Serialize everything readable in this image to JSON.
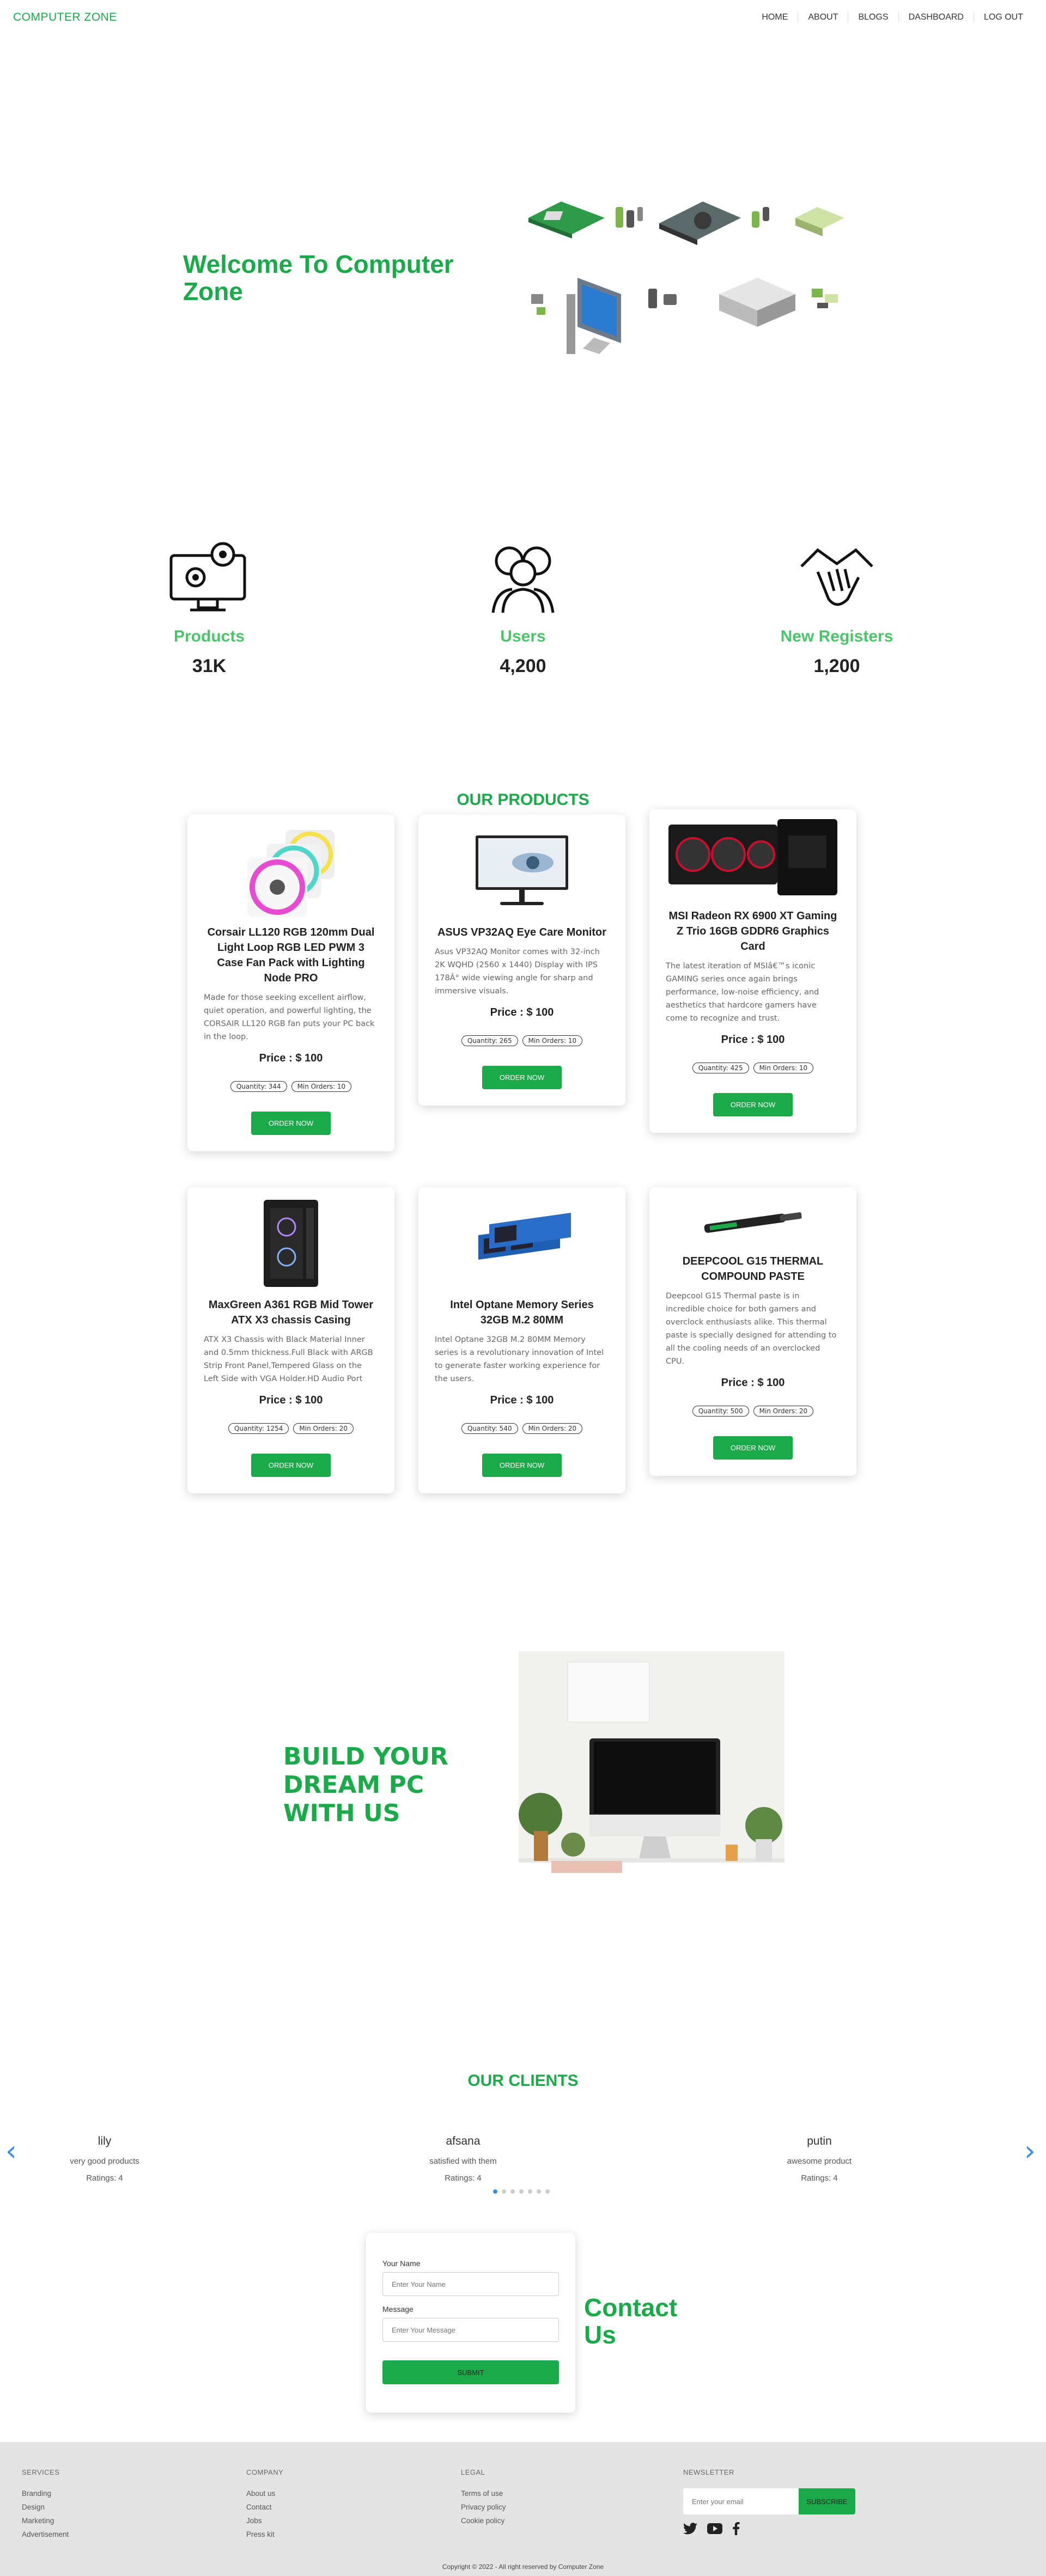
{
  "nav": {
    "brand": "COMPUTER ZONE",
    "links": [
      "HOME",
      "ABOUT",
      "BLOGS",
      "DASHBOARD",
      "LOG OUT"
    ]
  },
  "hero": {
    "title": "Welcome To Computer Zone"
  },
  "stats": [
    {
      "label": "Products",
      "value": "31K",
      "icon": "computer-settings-icon"
    },
    {
      "label": "Users",
      "value": "4,200",
      "icon": "users-icon"
    },
    {
      "label": "New Registers",
      "value": "1,200",
      "icon": "handshake-icon"
    }
  ],
  "products": {
    "title": "OUR PRODUCTS",
    "items": [
      {
        "name": "Corsair LL120 RGB 120mm Dual Light Loop RGB LED PWM 3 Case Fan Pack with Lighting Node PRO",
        "desc": "Made for those seeking excellent airflow, quiet operation, and powerful lighting, the CORSAIR LL120 RGB fan puts your PC back in the loop.",
        "price": "Price : $ 100",
        "quantity": "Quantity: 344",
        "min_orders": "Min Orders: 10",
        "button": "ORDER NOW"
      },
      {
        "name": "ASUS VP32AQ Eye Care Monitor",
        "desc": "Asus VP32AQ Monitor comes with 32-inch 2K WQHD (2560 x 1440) Display with IPS 178Â° wide viewing angle for sharp and immersive visuals.",
        "price": "Price : $ 100",
        "quantity": "Quantity: 265",
        "min_orders": "Min Orders: 10",
        "button": "ORDER NOW"
      },
      {
        "name": "MSI Radeon RX 6900 XT Gaming Z Trio 16GB GDDR6 Graphics Card",
        "desc": "The latest iteration of MSIâ€™s iconic GAMING series once again brings performance, low-noise efficiency, and aesthetics that hardcore gamers have come to recognize and trust.",
        "price": "Price : $ 100",
        "quantity": "Quantity: 425",
        "min_orders": "Min Orders: 10",
        "button": "ORDER NOW"
      },
      {
        "name": "MaxGreen A361 RGB Mid Tower ATX X3 chassis Casing",
        "desc": "ATX X3 Chassis with Black Material Inner and 0.5mm thickness.Full Black with ARGB Strip Front Panel,Tempered Glass on the Left Side with VGA Holder.HD Audio Port",
        "price": "Price : $ 100",
        "quantity": "Quantity: 1254",
        "min_orders": "Min Orders: 20",
        "button": "ORDER NOW"
      },
      {
        "name": "Intel Optane Memory Series 32GB M.2 80MM",
        "desc": "Intel Optane 32GB M.2 80MM Memory series is a revolutionary innovation of Intel to generate faster working experience for the users.",
        "price": "Price : $ 100",
        "quantity": "Quantity: 540",
        "min_orders": "Min Orders: 20",
        "button": "ORDER NOW"
      },
      {
        "name": "DEEPCOOL G15 THERMAL COMPOUND PASTE",
        "desc": "Deepcool G15 Thermal paste is in incredible choice for both gamers and overclock enthusiasts alike. This thermal paste is specially designed for attending to all the cooling needs of an overclocked CPU.",
        "price": "Price : $ 100",
        "quantity": "Quantity: 500",
        "min_orders": "Min Orders: 20",
        "button": "ORDER NOW"
      }
    ]
  },
  "dream": {
    "line1": "BUILD YOUR DREAM PC",
    "line2": "WITH US"
  },
  "clients": {
    "title": "OUR CLIENTS",
    "items": [
      {
        "name": "lily",
        "desc": "very good products",
        "rating": "Ratings: 4"
      },
      {
        "name": "afsana",
        "desc": "satisfied with them",
        "rating": "Ratings: 4"
      },
      {
        "name": "putin",
        "desc": "awesome product",
        "rating": "Ratings: 4"
      }
    ],
    "prev": "‹",
    "next": "›"
  },
  "contact": {
    "title_line1": "Contact",
    "title_line2": "Us",
    "name_label": "Your Name",
    "name_placeholder": "Enter Your Name",
    "message_label": "Message",
    "message_placeholder": "Enter Your Message",
    "submit": "SUBMIT"
  },
  "footer": {
    "services": {
      "title": "SERVICES",
      "links": [
        "Branding",
        "Design",
        "Marketing",
        "Advertisement"
      ]
    },
    "company": {
      "title": "COMPANY",
      "links": [
        "About us",
        "Contact",
        "Jobs",
        "Press kit"
      ]
    },
    "legal": {
      "title": "LEGAL",
      "links": [
        "Terms of use",
        "Privacy policy",
        "Cookie policy"
      ]
    },
    "newsletter": {
      "title": "NEWSLETTER",
      "placeholder": "Enter your email",
      "button": "SUBSCRIBE"
    },
    "copyright": "Copyright © 2022 - All right reserved by Computer Zone"
  },
  "colors": {
    "brand": "#1aaa4a",
    "accent": "#3a8ee6"
  }
}
